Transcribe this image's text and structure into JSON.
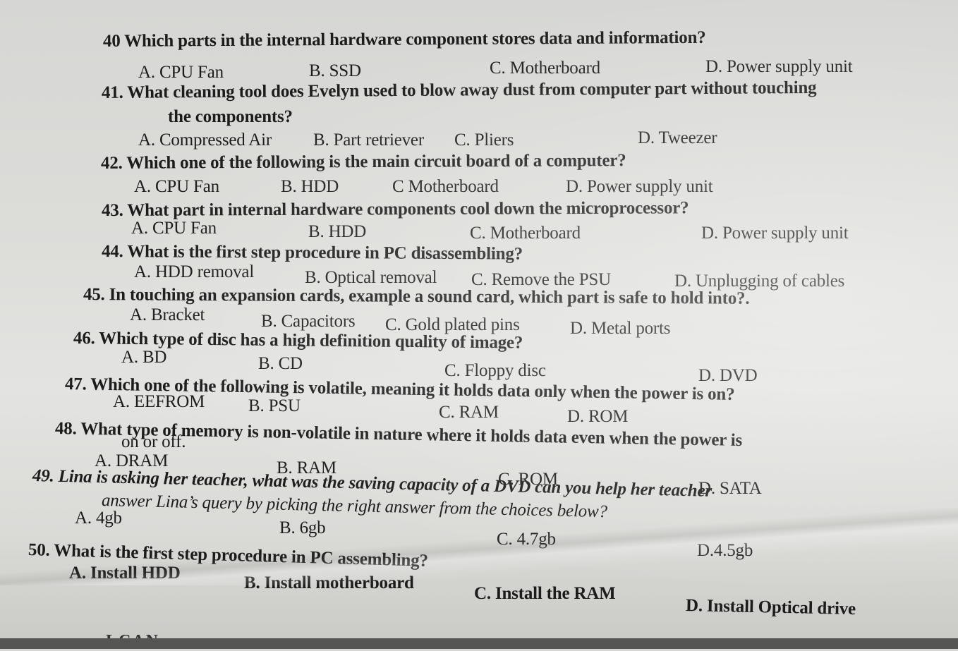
{
  "questions": [
    {
      "number": "40",
      "text": "40 Which parts in the internal hardware component stores data and information?",
      "options": [
        "A. CPU Fan",
        "B. SSD",
        "C. Motherboard",
        "D. Power supply unit"
      ]
    },
    {
      "number": "41",
      "text": "41. What cleaning tool does Evelyn used to blow away dust from computer part without touching",
      "text_cont": "the components?",
      "options": [
        "A. Compressed Air",
        "B. Part retriever",
        "C. Pliers",
        "D. Tweezer"
      ]
    },
    {
      "number": "42",
      "text": "42. Which one of the following is the main circuit board of a computer?",
      "options": [
        "A. CPU Fan",
        "B. HDD",
        "C Motherboard",
        "D. Power supply unit"
      ]
    },
    {
      "number": "43",
      "text": "43. What part in internal hardware components cool down the microprocessor?",
      "options": [
        "A. CPU Fan",
        "B. HDD",
        "C. Motherboard",
        "D. Power supply unit"
      ]
    },
    {
      "number": "44",
      "text": "44. What is the first step procedure in PC disassembling?",
      "options": [
        "A. HDD removal",
        "B. Optical removal",
        "C. Remove the PSU",
        "D. Unplugging of cables"
      ]
    },
    {
      "number": "45",
      "text": "45. In touching an expansion cards, example a sound card, which  part is safe to hold into?.",
      "options": [
        "A. Bracket",
        "B. Capacitors",
        "C.  Gold plated pins",
        "D.  Metal ports"
      ]
    },
    {
      "number": "46",
      "text": "46. Which type of disc has a high definition quality of image?",
      "options": [
        "A. BD",
        "B. CD",
        "C.  Floppy disc",
        "D.  DVD"
      ]
    },
    {
      "number": "47",
      "text": "47. Which one of the following is volatile, meaning it holds data only when the power is on?",
      "options": [
        "A. EEFROM",
        "B. PSU",
        "C.  RAM",
        "D.  ROM"
      ]
    },
    {
      "number": "48",
      "text": "48. What type of  memory is non-volatile in nature where it holds data even when the power is",
      "text_cont": "on or off.",
      "options": [
        "A. DRAM",
        "B. RAM",
        "C. ROM",
        "D. SATA"
      ]
    },
    {
      "number": "49",
      "text": "49. Lina is asking her teacher, what was the saving capacity of a DVD can you help her teacher",
      "text_cont": "answer Lina’s query by picking the right answer from the choices below?",
      "options": [
        "A. 4gb",
        "B. 6gb",
        "C. 4.7gb",
        "D.4.5gb"
      ]
    },
    {
      "number": "50",
      "text": "50. What is the first step procedure  in PC assembling?",
      "options": [
        "A. Install HDD",
        "B. Install motherboard",
        "C. Install the RAM",
        "D. Install Optical drive"
      ]
    }
  ],
  "partial_text": "LCAN"
}
